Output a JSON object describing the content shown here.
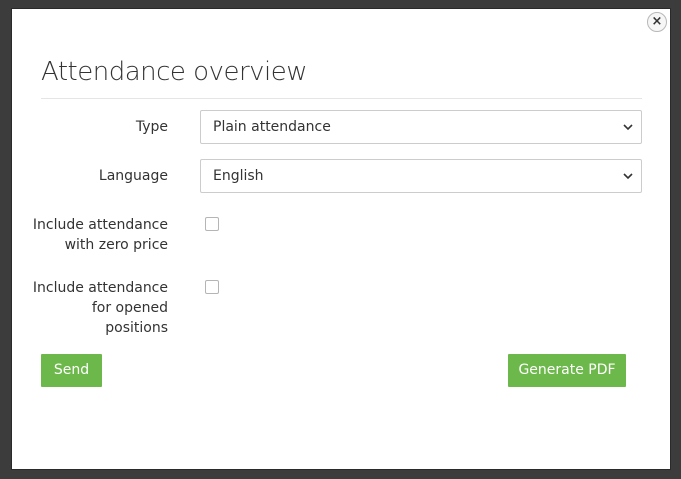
{
  "dialog": {
    "title": "Attendance overview",
    "close_symbol": "×"
  },
  "form": {
    "type": {
      "label": "Type",
      "value": "Plain attendance"
    },
    "language": {
      "label": "Language",
      "value": "English"
    },
    "zero_price": {
      "line1": "Include attendance",
      "line2": "with zero price",
      "checked": false
    },
    "opened_positions": {
      "line1": "Include attendance",
      "line2": "for opened",
      "line3": "positions",
      "checked": false
    }
  },
  "buttons": {
    "send": "Send",
    "generate_pdf": "Generate PDF"
  },
  "colors": {
    "button_green": "#6cb84a",
    "backdrop": "#3c3c3c"
  },
  "icons": {
    "close": "close-icon",
    "select_arrow": "chevron-down-icon"
  }
}
